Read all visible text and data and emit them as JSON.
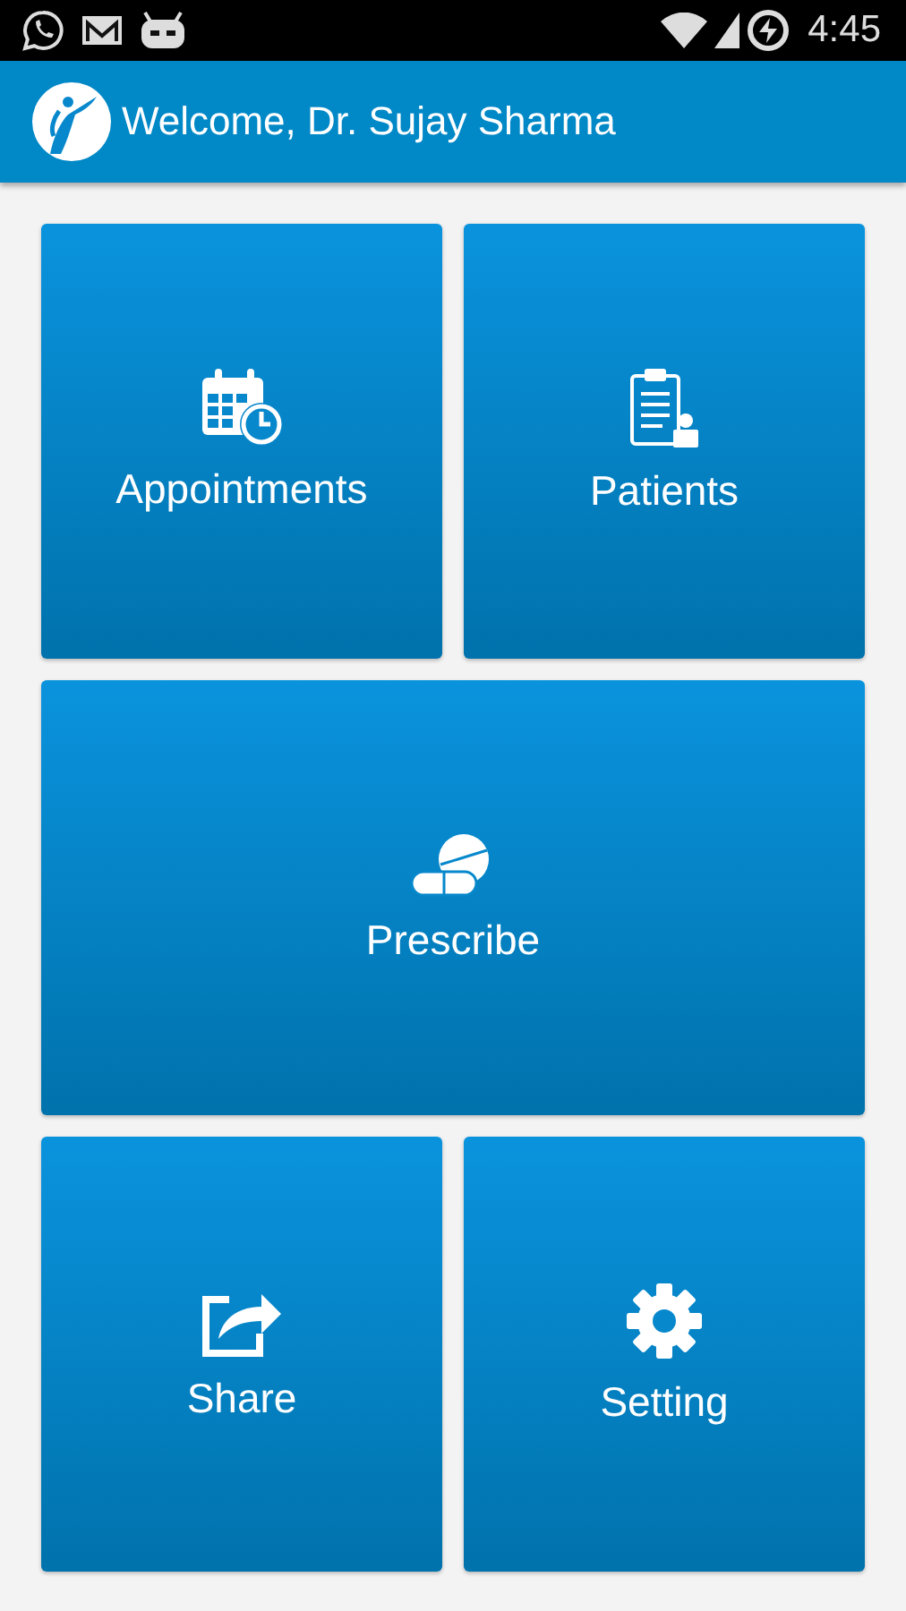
{
  "status_bar": {
    "time": "4:45"
  },
  "header": {
    "title": "Welcome, Dr. Sujay Sharma"
  },
  "tiles": [
    {
      "label": "Appointments",
      "kind": "calendar",
      "wide": false
    },
    {
      "label": "Patients",
      "kind": "clipboard",
      "wide": false
    },
    {
      "label": "Prescribe",
      "kind": "pills",
      "wide": true
    },
    {
      "label": "Share",
      "kind": "share",
      "wide": false
    },
    {
      "label": "Setting",
      "kind": "gear",
      "wide": false
    }
  ]
}
